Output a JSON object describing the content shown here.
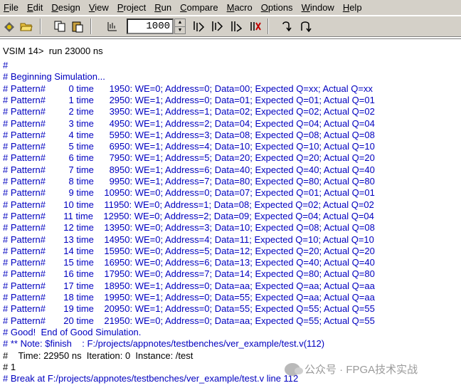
{
  "menu": [
    "File",
    "Edit",
    "Design",
    "View",
    "Project",
    "Run",
    "Compare",
    "Macro",
    "Options",
    "Window",
    "Help"
  ],
  "toolbar": {
    "run_length": "1000",
    "icons": [
      "open-design-icon",
      "open-folder-icon",
      "copy-icon",
      "paste-icon",
      "run-length-icon",
      "run-icon",
      "run-continue-icon",
      "run-all-icon",
      "break-icon",
      "step-icon",
      "step-over-icon"
    ]
  },
  "transcript": {
    "prompt": "VSIM 14>",
    "command": "run 23000 ns",
    "lines": [
      "#",
      "# Beginning Simulation...",
      "# Pattern#         0 time      1950: WE=0; Address=0; Data=00; Expected Q=xx; Actual Q=xx",
      "# Pattern#         1 time      2950: WE=1; Address=0; Data=01; Expected Q=01; Actual Q=01",
      "# Pattern#         2 time      3950: WE=1; Address=1; Data=02; Expected Q=02; Actual Q=02",
      "# Pattern#         3 time      4950: WE=1; Address=2; Data=04; Expected Q=04; Actual Q=04",
      "# Pattern#         4 time      5950: WE=1; Address=3; Data=08; Expected Q=08; Actual Q=08",
      "# Pattern#         5 time      6950: WE=1; Address=4; Data=10; Expected Q=10; Actual Q=10",
      "# Pattern#         6 time      7950: WE=1; Address=5; Data=20; Expected Q=20; Actual Q=20",
      "# Pattern#         7 time      8950: WE=1; Address=6; Data=40; Expected Q=40; Actual Q=40",
      "# Pattern#         8 time      9950: WE=1; Address=7; Data=80; Expected Q=80; Actual Q=80",
      "# Pattern#         9 time    10950: WE=0; Address=0; Data=07; Expected Q=01; Actual Q=01",
      "# Pattern#       10 time    11950: WE=0; Address=1; Data=08; Expected Q=02; Actual Q=02",
      "# Pattern#       11 time    12950: WE=0; Address=2; Data=09; Expected Q=04; Actual Q=04",
      "# Pattern#       12 time    13950: WE=0; Address=3; Data=10; Expected Q=08; Actual Q=08",
      "# Pattern#       13 time    14950: WE=0; Address=4; Data=11; Expected Q=10; Actual Q=10",
      "# Pattern#       14 time    15950: WE=0; Address=5; Data=12; Expected Q=20; Actual Q=20",
      "# Pattern#       15 time    16950: WE=0; Address=6; Data=13; Expected Q=40; Actual Q=40",
      "# Pattern#       16 time    17950: WE=0; Address=7; Data=14; Expected Q=80; Actual Q=80",
      "# Pattern#       17 time    18950: WE=1; Address=0; Data=aa; Expected Q=aa; Actual Q=aa",
      "# Pattern#       18 time    19950: WE=1; Address=0; Data=55; Expected Q=aa; Actual Q=aa",
      "# Pattern#       19 time    20950: WE=1; Address=0; Data=55; Expected Q=55; Actual Q=55",
      "# Pattern#       20 time    21950: WE=0; Address=0; Data=aa; Expected Q=55; Actual Q=55",
      "# Good!  End of Good Simulation.",
      "# ** Note: $finish    : F:/projects/appnotes/testbenches/ver_example/test.v(112)",
      "#    Time: 22950 ns  Iteration: 0  Instance: /test",
      "# 1",
      "# Break at F:/projects/appnotes/testbenches/ver_example/test.v line 112"
    ],
    "black_lines": [
      25,
      26
    ]
  },
  "watermark": "公众号 · FPGA技术实战"
}
